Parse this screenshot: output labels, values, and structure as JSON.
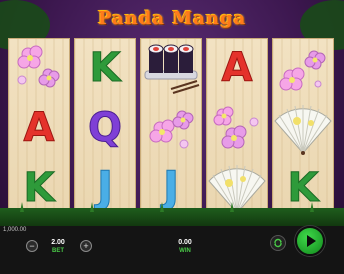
{
  "game": {
    "title": "Panda Manga",
    "colors": {
      "title": "#ff7a1a",
      "accent": "#49c947",
      "spin": "#1fa12a"
    }
  },
  "reels": [
    {
      "symbols": [
        "cherry-blossom",
        "letter-A",
        "letter-K"
      ]
    },
    {
      "symbols": [
        "letter-K",
        "letter-Q",
        "letter-J"
      ]
    },
    {
      "symbols": [
        "sushi-rolls",
        "cherry-blossom",
        "letter-J"
      ]
    },
    {
      "symbols": [
        "letter-A",
        "cherry-blossom",
        "paper-fan"
      ]
    },
    {
      "symbols": [
        "cherry-blossom",
        "paper-fan",
        "letter-K"
      ]
    }
  ],
  "hud": {
    "balance": "1,000.00",
    "bet_value": "2.00",
    "bet_label": "BET",
    "win_value": "0.00",
    "win_label": "WIN",
    "decrease_glyph": "−",
    "increase_glyph": "+"
  }
}
